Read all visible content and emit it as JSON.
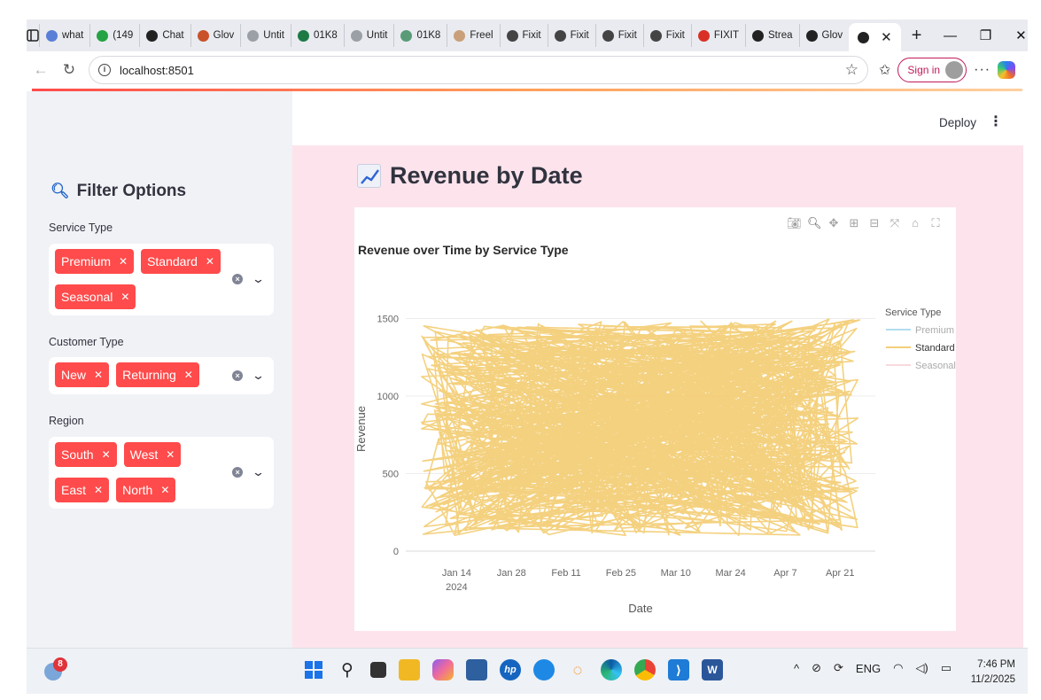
{
  "browser": {
    "tabs": [
      {
        "title": "what",
        "icon": "search-tab-icon",
        "color": "#5a7fd6"
      },
      {
        "title": "(149",
        "icon": "badge-tab-icon",
        "color": "#25a244"
      },
      {
        "title": "Chat",
        "icon": "chatgpt-tab-icon",
        "color": "#222222"
      },
      {
        "title": "Glov",
        "icon": "glove-tab-icon",
        "color": "#c9522a"
      },
      {
        "title": "Untit",
        "icon": "document-tab-icon",
        "color": "#9aa0a6"
      },
      {
        "title": "01K8",
        "icon": "excel-tab-icon",
        "color": "#1d7a45"
      },
      {
        "title": "Untit",
        "icon": "document-tab-icon",
        "color": "#9aa0a6"
      },
      {
        "title": "01K8",
        "icon": "sheet-tab-icon",
        "color": "#5a9b77"
      },
      {
        "title": "Freel",
        "icon": "freelance-tab-icon",
        "color": "#c9a07a"
      },
      {
        "title": "Fixit",
        "icon": "github-tab-icon",
        "color": "#444444"
      },
      {
        "title": "Fixit",
        "icon": "github-tab-icon",
        "color": "#444444"
      },
      {
        "title": "Fixit",
        "icon": "github-tab-icon",
        "color": "#444444"
      },
      {
        "title": "Fixit",
        "icon": "github-tab-icon",
        "color": "#444444"
      },
      {
        "title": "FIXIT",
        "icon": "pdf-tab-icon",
        "color": "#d93025"
      },
      {
        "title": "Strea",
        "icon": "streamlit-tab-icon",
        "color": "#222222"
      },
      {
        "title": "Glov",
        "icon": "streamlit-tab-icon",
        "color": "#222222"
      }
    ],
    "url": "localhost:8501",
    "sign_in_label": "Sign in"
  },
  "header": {
    "deploy_label": "Deploy"
  },
  "sidebar": {
    "title": "Filter Options",
    "filters": [
      {
        "label": "Service Type",
        "chips": [
          "Premium",
          "Standard",
          "Seasonal"
        ]
      },
      {
        "label": "Customer Type",
        "chips": [
          "New",
          "Returning"
        ]
      },
      {
        "label": "Region",
        "chips": [
          "South",
          "West",
          "East",
          "North"
        ]
      }
    ],
    "chip_color": "#ff4b4b"
  },
  "main": {
    "page_title": "Revenue by Date"
  },
  "chart_data": {
    "type": "line",
    "title": "Revenue over Time by Service Type",
    "xlabel": "Date",
    "ylabel": "Revenue",
    "ylim": [
      0,
      1600
    ],
    "y_ticks": [
      "0",
      "500",
      "1000",
      "1500"
    ],
    "x_ticks": [
      "Jan 14",
      "Jan 28",
      "Feb 11",
      "Feb 25",
      "Mar 10",
      "Mar 24",
      "Apr 7",
      "Apr 21"
    ],
    "x_tick_sublabel": "2024",
    "x_range": [
      "2024-01-01",
      "2024-04-30"
    ],
    "y_data_range": [
      100,
      1500
    ],
    "legend_title": "Service Type",
    "legend_placement": "right",
    "series": [
      {
        "name": "Premium",
        "color": "#7ec8e3",
        "visible": false
      },
      {
        "name": "Standard",
        "color": "#f3cf78",
        "visible": true
      },
      {
        "name": "Seasonal",
        "color": "#f5c2c7",
        "visible": false
      }
    ]
  },
  "taskbar": {
    "weather_badge": "8",
    "language": "ENG",
    "time": "7:46 PM",
    "date": "11/2/2025"
  }
}
